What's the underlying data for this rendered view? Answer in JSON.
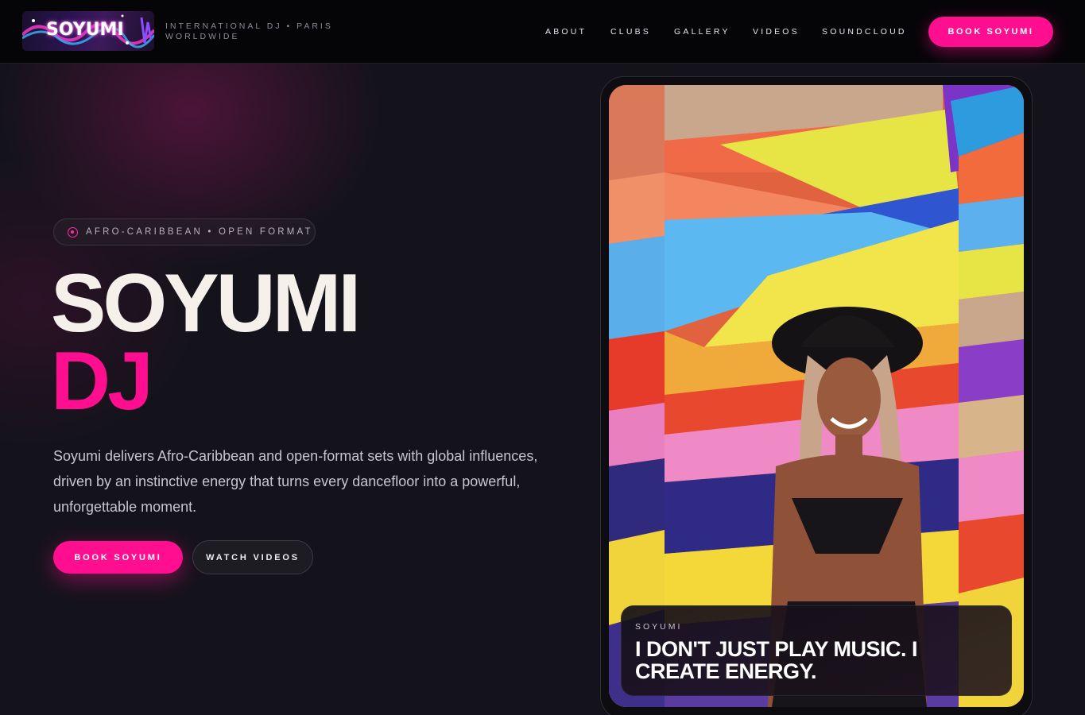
{
  "header": {
    "logo_text": "SOYUMI",
    "tagline": "INTERNATIONAL DJ • PARIS WORLDWIDE",
    "nav": [
      "ABOUT",
      "CLUBS",
      "GALLERY",
      "VIDEOS",
      "SOUNDCLOUD"
    ],
    "book_button": "BOOK SOYUMI"
  },
  "hero": {
    "pill_text": "AFRO-CARIBBEAN • OPEN FORMAT",
    "title_line1": "SOYUMI",
    "title_line2": "DJ",
    "description": "Soyumi delivers Afro-Caribbean and open-format sets with global influences, driven by an instinctive energy that turns every dancefloor into a powerful, unforgettable moment.",
    "book_button": "BOOK SOYUMI",
    "videos_button": "WATCH VIDEOS"
  },
  "card": {
    "quote_label": "SOYUMI",
    "quote_text": "I DON'T JUST PLAY MUSIC. I CREATE ENERGY."
  },
  "colors": {
    "accent": "#ff0f8f",
    "background": "#14131b",
    "header_bg": "#050508",
    "title": "#f5f1ea"
  },
  "icons": {
    "pill_icon": "record-icon"
  }
}
